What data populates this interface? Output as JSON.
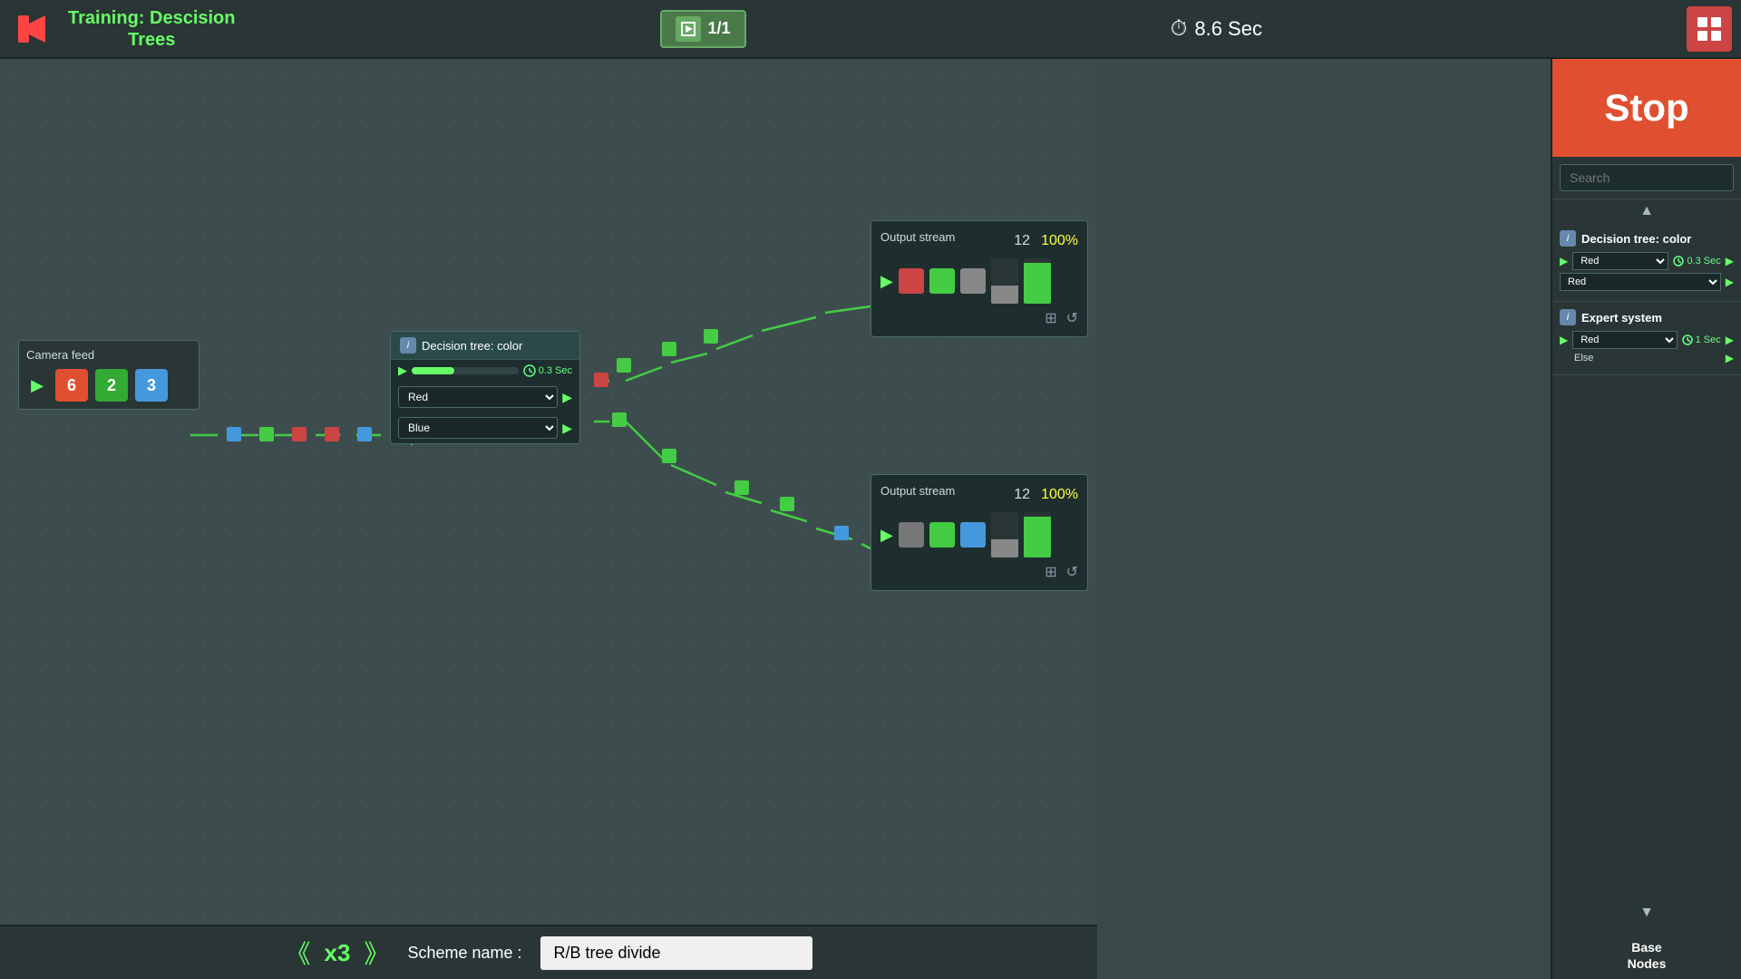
{
  "header": {
    "back_label": "←",
    "title_line1": "Training: Descision",
    "title_line2": "Trees",
    "page_current": "1",
    "page_total": "1",
    "page_label": "1/1",
    "timer_label": "8.6 Sec",
    "timer_icon": "⏱"
  },
  "stop_button": {
    "label": "Stop"
  },
  "search": {
    "placeholder": "Search"
  },
  "panel": {
    "scroll_up": "▲",
    "scroll_down": "▼",
    "item1": {
      "title": "Decision tree: color",
      "info": "i",
      "row1_value": "Red",
      "row1_timing": "0.3 Sec",
      "row2_value": "Red"
    },
    "item2": {
      "title": "Expert system",
      "info": "i",
      "row1_value": "Red",
      "row1_timing": "1 Sec",
      "row2_label": "Else"
    }
  },
  "canvas": {
    "camera_feed": {
      "title": "Camera feed",
      "item1": "6",
      "item2": "2",
      "item3": "3"
    },
    "decision_node": {
      "title": "Decision tree: color",
      "info": "i",
      "branch1": "Red",
      "branch2": "Blue",
      "timing": "0.3 Sec"
    },
    "output_top": {
      "title": "Output stream",
      "count": "12",
      "percent": "100%"
    },
    "output_bottom": {
      "title": "Output stream",
      "count": "12",
      "percent": "100%"
    }
  },
  "bottom_bar": {
    "arrow_left": "《",
    "multiplier": "x3",
    "arrow_right": "》",
    "scheme_label": "Scheme name :",
    "scheme_value": "R/B tree divide"
  },
  "base_nodes": {
    "line1": "Base",
    "line2": "Nodes"
  }
}
